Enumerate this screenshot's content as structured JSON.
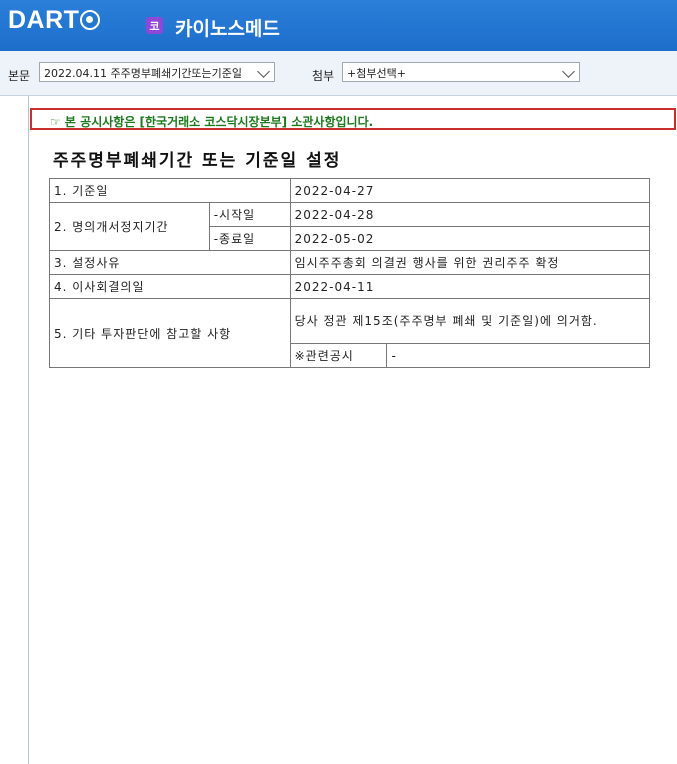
{
  "header": {
    "logo_text": "DART",
    "badge_char": "코",
    "company_name": "카이노스메드"
  },
  "toolbar": {
    "body_label": "본문",
    "body_select_value": "2022.04.11  주주명부폐쇄기간또는기준일",
    "attach_label": "첨부",
    "attach_select_value": "+첨부선택+"
  },
  "document": {
    "notice": "☞ 본 공시사항은 [한국거래소 코스닥시장본부] 소관사항입니다.",
    "title": "주주명부폐쇄기간 또는 기준일 설정",
    "rows": {
      "record_date_label": "1. 기준일",
      "record_date_value": "2022-04-27",
      "period_label": "2. 명의개서정지기간",
      "start_label": "-시작일",
      "start_value": "2022-04-28",
      "end_label": "-종료일",
      "end_value": "2022-05-02",
      "reason_label": "3. 설정사유",
      "reason_value": "임시주주총회 의결권 행사를 위한 권리주주 확정",
      "board_label": "4. 이사회결의일",
      "board_value": "2022-04-11",
      "other_label": "5. 기타 투자판단에 참고할 사항",
      "other_value": "당사 정관 제15조(주주명부 폐쇄 및 기준일)에 의거함.",
      "related_label": "※관련공시",
      "related_value": "-"
    }
  }
}
